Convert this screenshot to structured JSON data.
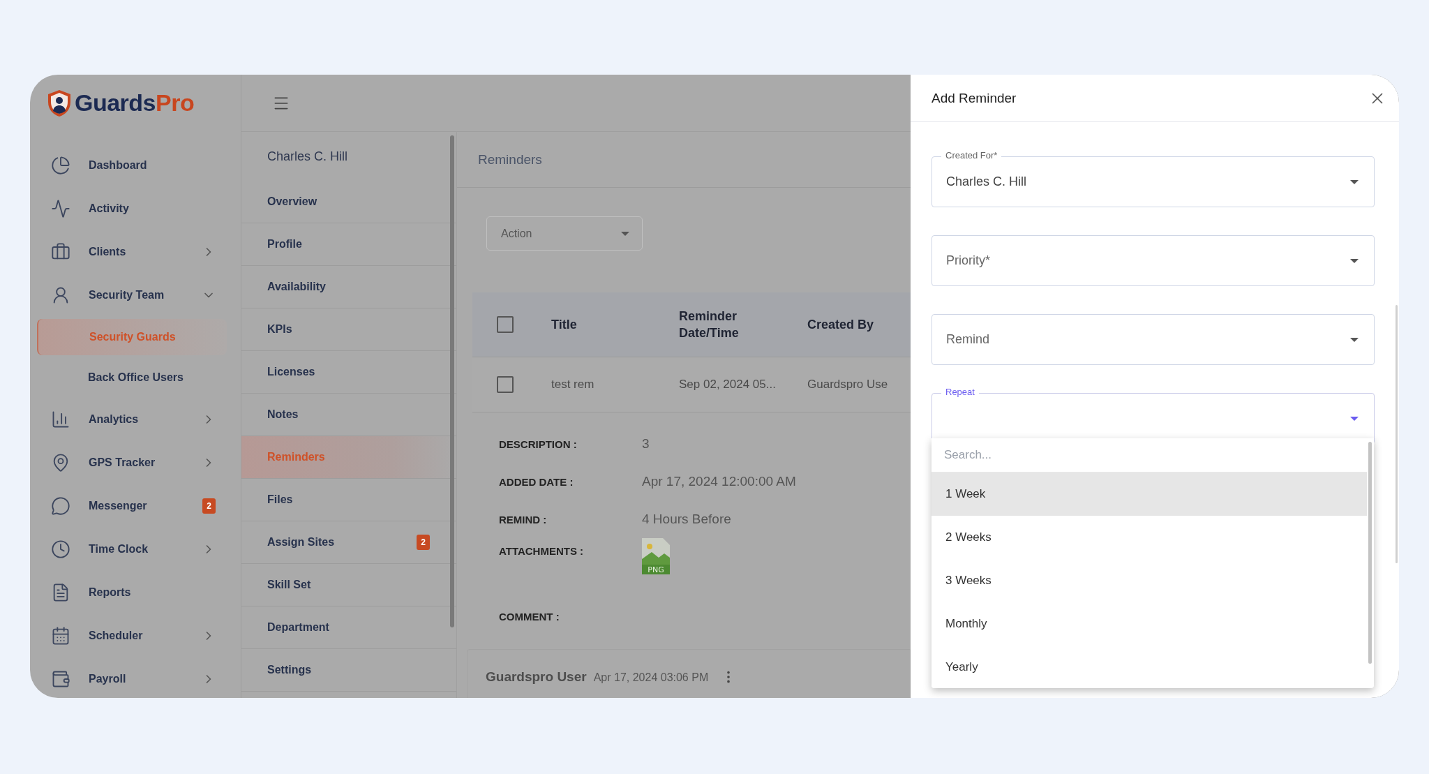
{
  "logo": {
    "primary": "Guards",
    "accent": "Pro"
  },
  "sidebar": {
    "items": [
      {
        "label": "Dashboard",
        "selected": false
      },
      {
        "label": "Activity",
        "selected": false
      },
      {
        "label": "Clients",
        "selected": false,
        "expanded": false
      },
      {
        "label": "Security Team",
        "selected": false,
        "expanded": true,
        "children": [
          {
            "label": "Security Guards",
            "selected": true
          },
          {
            "label": "Back Office Users",
            "selected": false
          }
        ]
      },
      {
        "label": "Analytics",
        "selected": false,
        "expanded": false
      },
      {
        "label": "GPS Tracker",
        "selected": false,
        "expanded": false
      },
      {
        "label": "Messenger",
        "selected": false,
        "badge": "2"
      },
      {
        "label": "Time Clock",
        "selected": false,
        "expanded": false
      },
      {
        "label": "Reports",
        "selected": false
      },
      {
        "label": "Scheduler",
        "selected": false,
        "expanded": false
      },
      {
        "label": "Payroll",
        "selected": false,
        "expanded": false
      }
    ]
  },
  "profile_menu": {
    "person": "Charles C. Hill",
    "items": [
      {
        "label": "Overview",
        "selected": false
      },
      {
        "label": "Profile",
        "selected": false
      },
      {
        "label": "Availability",
        "selected": false
      },
      {
        "label": "KPIs",
        "selected": false
      },
      {
        "label": "Licenses",
        "selected": false
      },
      {
        "label": "Notes",
        "selected": false
      },
      {
        "label": "Reminders",
        "selected": true
      },
      {
        "label": "Files",
        "selected": false
      },
      {
        "label": "Assign Sites",
        "selected": false,
        "badge": "2"
      },
      {
        "label": "Skill Set",
        "selected": false
      },
      {
        "label": "Department",
        "selected": false
      },
      {
        "label": "Settings",
        "selected": false
      }
    ]
  },
  "reminders": {
    "title": "Reminders",
    "action": {
      "placeholder": "Action"
    },
    "table": {
      "header_checked": false,
      "columns": [
        "Title",
        "Reminder Date/Time",
        "Created By"
      ],
      "rows": [
        {
          "checked": false,
          "cells": [
            "test rem",
            "Sep 02, 2024 05...",
            "Guardspro Use"
          ]
        }
      ]
    },
    "details": [
      {
        "kind": "text",
        "label": "DESCRIPTION :",
        "value": "3"
      },
      {
        "kind": "text",
        "label": "ADDED DATE :",
        "value": "Apr 17, 2024 12:00:00 AM"
      },
      {
        "kind": "text",
        "label": "REMIND :",
        "value": "4 Hours Before"
      },
      {
        "kind": "attachment",
        "label": "ATTACHMENTS :",
        "value": "PNG"
      },
      {
        "kind": "heading",
        "label": "COMMENT :"
      }
    ],
    "comment": {
      "author": "Guardspro User",
      "time": "Apr 17, 2024 03:06 PM"
    }
  },
  "drawer": {
    "title": "Add Reminder",
    "fields": [
      {
        "label": "Created For*",
        "value": "Charles C. Hill",
        "focused": false
      },
      {
        "label": "Priority*",
        "focused": false
      },
      {
        "label": "Remind",
        "focused": false
      },
      {
        "label": "Repeat",
        "focused": true
      }
    ],
    "dropdown": {
      "placeholder": "Search...",
      "options": [
        {
          "label": "1 Week",
          "selected": true
        },
        {
          "label": "2 Weeks",
          "selected": false
        },
        {
          "label": "3 Weeks",
          "selected": false
        },
        {
          "label": "Monthly",
          "selected": false
        },
        {
          "label": "Yearly",
          "selected": false
        }
      ]
    }
  }
}
